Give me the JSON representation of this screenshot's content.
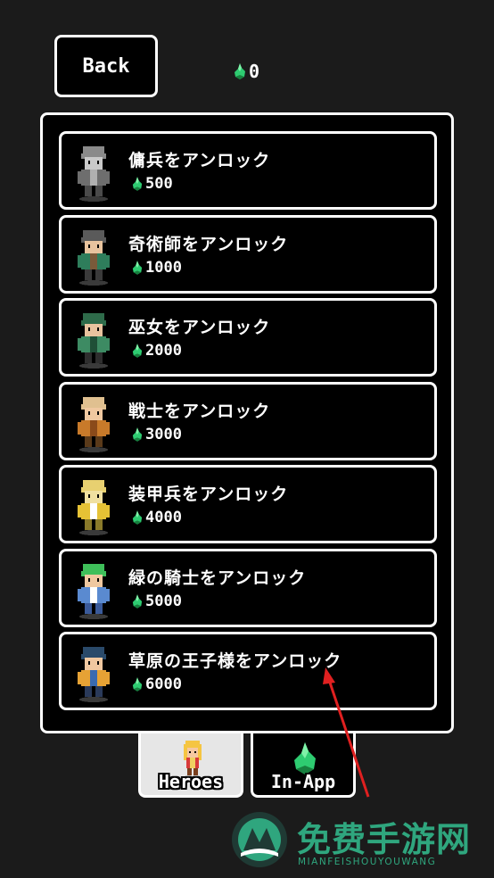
{
  "back_label": "Back",
  "currency": {
    "amount": "0",
    "icon": "green-gem-icon",
    "color": "#2ecc71"
  },
  "heroes": [
    {
      "title": "傭兵をアンロック",
      "price": "500",
      "sprite": "mercenary-sprite"
    },
    {
      "title": "奇術師をアンロック",
      "price": "1000",
      "sprite": "magician-sprite"
    },
    {
      "title": "巫女をアンロック",
      "price": "2000",
      "sprite": "shrine-maiden-sprite"
    },
    {
      "title": "戦士をアンロック",
      "price": "3000",
      "sprite": "warrior-sprite"
    },
    {
      "title": "装甲兵をアンロック",
      "price": "4000",
      "sprite": "armored-soldier-sprite"
    },
    {
      "title": "緑の騎士をアンロック",
      "price": "5000",
      "sprite": "green-knight-sprite"
    },
    {
      "title": "草原の王子様をアンロック",
      "price": "6000",
      "sprite": "prairie-prince-sprite"
    }
  ],
  "tabs": [
    {
      "label": "Heroes",
      "icon": "hero-icon",
      "selected": true
    },
    {
      "label": "In-App",
      "icon": "green-gem-icon",
      "selected": false
    }
  ],
  "watermark": {
    "title": "免费手游网",
    "subtitle": "MIANFEISHOUYOUWANG",
    "color": "#2fa67e"
  },
  "annotation": {
    "color": "#e02020"
  }
}
